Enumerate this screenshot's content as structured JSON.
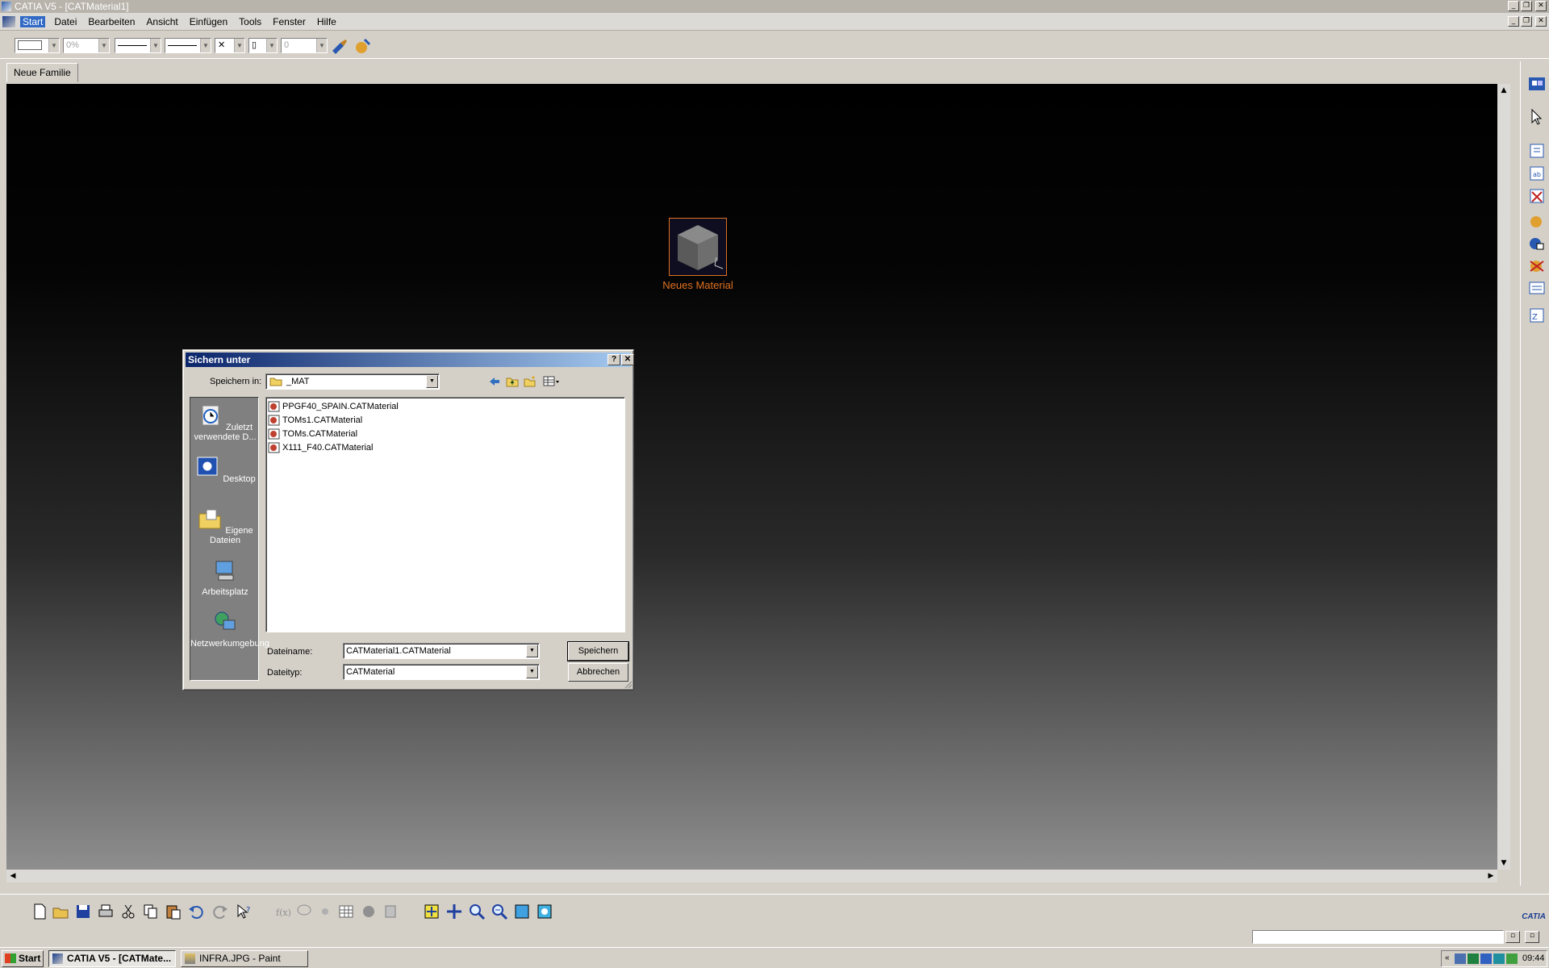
{
  "app": {
    "title": "CATIA V5 - [CATMaterial1]"
  },
  "menubar": {
    "items": [
      "Start",
      "Datei",
      "Bearbeiten",
      "Ansicht",
      "Einfügen",
      "Tools",
      "Fenster",
      "Hilfe"
    ]
  },
  "toolbar": {
    "transparency": "0%",
    "thickness": "0"
  },
  "tab": {
    "label": "Neue Familie"
  },
  "viewport": {
    "material_label": "Neues Material"
  },
  "dialog": {
    "title": "Sichern unter",
    "help_button": "?",
    "close_button": "✕",
    "save_in_label": "Speichern in:",
    "save_in_value": "_MAT",
    "places": [
      "Zuletzt verwendete D...",
      "Desktop",
      "Eigene Dateien",
      "Arbeitsplatz",
      "Netzwerkumgebung"
    ],
    "files": [
      "PPGF40_SPAIN.CATMaterial",
      "TOMs1.CATMaterial",
      "TOMs.CATMaterial",
      "X111_F40.CATMaterial"
    ],
    "filename_label": "Dateiname:",
    "filename_value": "CATMaterial1.CATMaterial",
    "filetype_label": "Dateityp:",
    "filetype_value": "CATMaterial",
    "save_button": "Speichern",
    "cancel_button": "Abbrechen"
  },
  "taskbar": {
    "start": "Start",
    "tasks": [
      "CATIA V5 - [CATMate...",
      "INFRA.JPG - Paint"
    ],
    "clock": "09:44"
  },
  "brand": {
    "logo_text": "CATIA"
  },
  "colors": {
    "accent_title": "#0a246a",
    "material_label": "#e07020",
    "menu_active": "#316ac5"
  }
}
